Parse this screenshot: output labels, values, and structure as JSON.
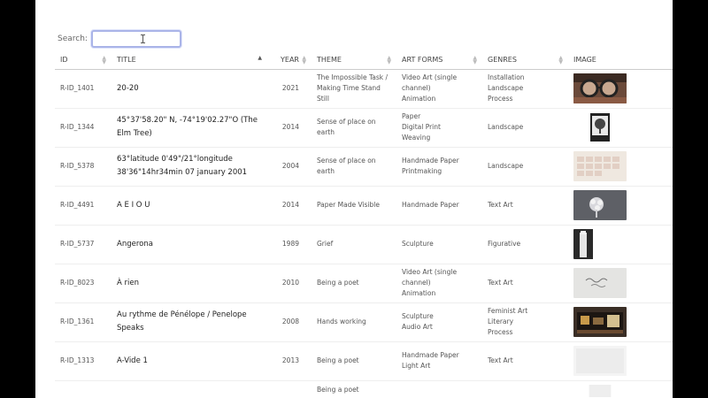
{
  "search": {
    "label": "Search:",
    "value": ""
  },
  "columns": [
    "ID",
    "TITLE",
    "YEAR",
    "THEME",
    "ART FORMS",
    "GENRES",
    "IMAGE"
  ],
  "rows": [
    {
      "id": "R-ID_1401",
      "title": "20-20",
      "year": "2021",
      "theme": [
        "The Impossible Task /",
        "Making Time Stand Still"
      ],
      "art_forms": [
        "Video Art (single",
        "channel)",
        "Animation"
      ],
      "genres": [
        "Installation",
        "Landscape",
        "Process"
      ],
      "image": "glasses-portrait-thumbnail"
    },
    {
      "id": "R-ID_1344",
      "title": "45°37'58.20\" N, -74°19'02.27\"O (The Elm Tree)",
      "year": "2014",
      "theme": [
        "Sense of place on earth"
      ],
      "art_forms": [
        "Paper",
        "Digital Print",
        "Weaving"
      ],
      "genres": [
        "Landscape"
      ],
      "image": "tree-print-thumbnail"
    },
    {
      "id": "R-ID_5378",
      "title": "63°latitude 0'49\"/21°longitude 38'36\"14hr34min 07 january 2001",
      "year": "2004",
      "theme": [
        "Sense of place on earth"
      ],
      "art_forms": [
        "Handmade Paper",
        "Printmaking"
      ],
      "genres": [
        "Landscape"
      ],
      "image": "paper-grid-thumbnail"
    },
    {
      "id": "R-ID_4491",
      "title": "A E I O U",
      "year": "2014",
      "theme": [
        "Paper Made Visible"
      ],
      "art_forms": [
        "Handmade Paper"
      ],
      "genres": [
        "Text Art"
      ],
      "image": "paper-flower-thumbnail"
    },
    {
      "id": "R-ID_5737",
      "title": "Angerona",
      "year": "1989",
      "theme": [
        "Grief"
      ],
      "art_forms": [
        "Sculpture"
      ],
      "genres": [
        "Figurative"
      ],
      "image": "sculpture-thumbnail"
    },
    {
      "id": "R-ID_8023",
      "title": "À rien",
      "year": "2010",
      "theme": [
        "Being a poet"
      ],
      "art_forms": [
        "Video Art (single",
        "channel)",
        "Animation"
      ],
      "genres": [
        "Text Art"
      ],
      "image": "handwriting-thumbnail"
    },
    {
      "id": "R-ID_1361",
      "title": "Au rythme de Pénélope / Penelope Speaks",
      "year": "2008",
      "theme": [
        "Hands working"
      ],
      "art_forms": [
        "Sculpture",
        "Audio Art"
      ],
      "genres": [
        "Feminist Art",
        "Literary",
        "Process"
      ],
      "image": "box-sculpture-thumbnail"
    },
    {
      "id": "R-ID_1313",
      "title": "A-Vide 1",
      "year": "2013",
      "theme": [
        "Being a poet"
      ],
      "art_forms": [
        "Handmade Paper",
        "Light Art"
      ],
      "genres": [
        "Text Art"
      ],
      "image": "white-paper-thumbnail"
    },
    {
      "id": "",
      "title": "",
      "year": "",
      "theme": [
        "Being a poet"
      ],
      "art_forms": [],
      "genres": [],
      "image": "partial-thumbnail"
    }
  ],
  "colors": {
    "search_border": "#aab4e8",
    "backdrop": "#000000",
    "page": "#ffffff"
  }
}
